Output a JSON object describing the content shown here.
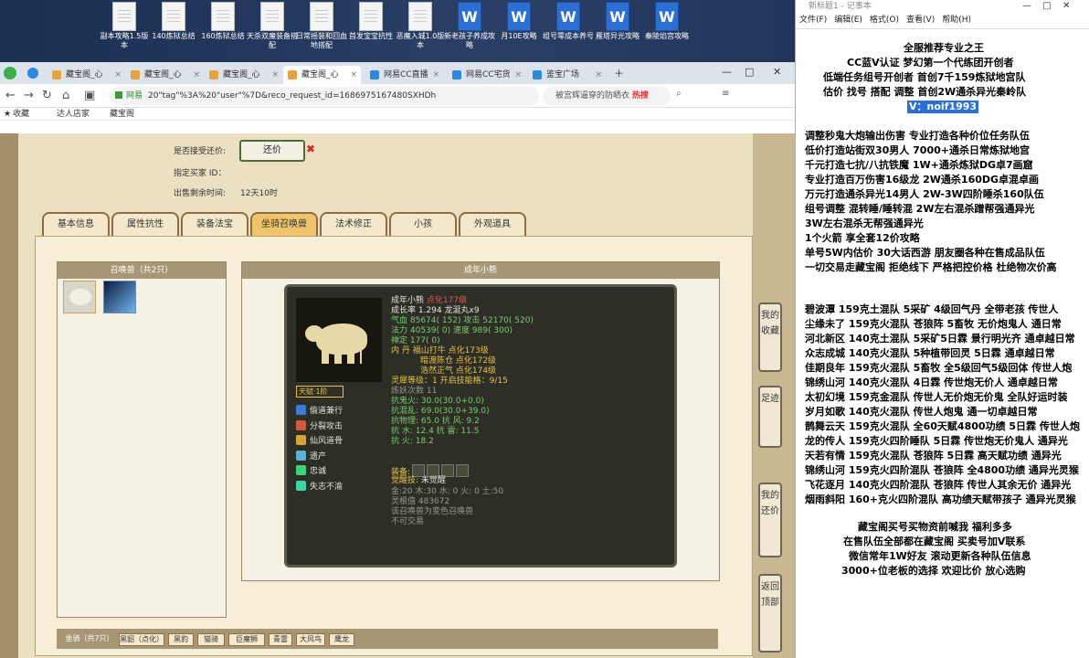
{
  "desktop": {
    "icons": [
      {
        "label": "副本攻略1.5版本",
        "word": false
      },
      {
        "label": "140炼狱总结",
        "word": false
      },
      {
        "label": "160炼狱总结",
        "word": false
      },
      {
        "label": "天杀双魔装备搭配",
        "word": false
      },
      {
        "label": "日常摇装和回血地搭配",
        "word": false
      },
      {
        "label": "首发宝宝抗性",
        "word": false
      },
      {
        "label": "恶魔入城1.0版本",
        "word": false
      },
      {
        "label": "新老孩子养成攻略",
        "word": true
      },
      {
        "label": "月10E攻略",
        "word": true
      },
      {
        "label": "组号零成本养号",
        "word": true
      },
      {
        "label": "雁塔异光攻略",
        "word": true
      },
      {
        "label": "秦陵焰宫攻略",
        "word": true
      }
    ]
  },
  "browser": {
    "tabs": [
      "藏宝阁_心",
      "藏宝阁_心",
      "藏宝阁_心",
      "藏宝阁_心",
      "网易CC直播",
      "网易CC宅货",
      "鉴宝广场"
    ],
    "url_site": "网易",
    "url": "20\"tag\"%3A%20\"user\"%7D&reco_request_id=1686975167480SXHDh",
    "search_text": "被宫辉逼穿的防晒衣",
    "hot_label": "热搜",
    "bookmarks": [
      "收藏",
      "达人店家",
      "藏宝阁"
    ]
  },
  "page": {
    "accept_label": "是否接受还价:",
    "counter_button": "还价",
    "buyer_label": "指定买家 ID：",
    "remaining_label": "出售剩余时间:",
    "remaining_value": "12天10时",
    "tabs": [
      "基本信息",
      "属性抗性",
      "装备法宝",
      "坐骑召唤兽",
      "法术修正",
      "小孩",
      "外观道具"
    ],
    "summon_header": "召唤兽（共2只）",
    "detail_header": "成年小熊",
    "pet": {
      "name_line": "成年小熊",
      "ding": "点化177级",
      "growth": "成长率 1.294 龙涎丸x9",
      "hp": "气血 85674( 152) 攻击 52170( 520)",
      "mp": "法力 40539( 0) 速度 989( 300)",
      "zen": "禅定 177( 0)",
      "neidan": "内  丹 福山打牛 点化173级",
      "neidan2": "暗渡陈仓 点化172级",
      "neidan3": "浩然正气 点化174级",
      "talent": "天赋·1阶",
      "spirit": "灵犀等级：1 开启技能格：9/15",
      "demon": "炼妖次数 11",
      "ghostfire": "抗鬼火: 30.0(30.0+0.0)",
      "chaos": "抗混乱: 69.0(30.0+39.0)",
      "poison": "抗物理: 65.0 抗   风: 9.2",
      "water": "抗   水: 12.4 抗   雷: 11.5",
      "fire": "抗   火: 18.2",
      "equip_label": "装备:",
      "awaken_label": "觉醒技:",
      "awaken_value": "未觉醒",
      "elements": "金:20 木:30 水: 0 火: 0 土:50",
      "jinglin": "灵根值 483672",
      "note1": "该召唤兽为变色召唤兽",
      "note2": "不可交易",
      "skills": [
        "偷道兼行",
        "分裂攻击",
        "仙风道骨",
        "遗产",
        "忠诚",
        "失志不渝"
      ]
    },
    "bottom_tabs": [
      "坐骑（共7只）",
      "黑貂（点化）",
      "黑豹",
      "猫骑",
      "巨魔狮",
      "青雷",
      "大风鸟",
      "鹰龙"
    ],
    "side_buttons": [
      "我的收藏",
      "足迹",
      "我的还价",
      "返回顶部"
    ]
  },
  "notepad": {
    "title": "新标题1 - 记事本",
    "menu": [
      "文件(F)",
      "编辑(E)",
      "格式(O)",
      "查看(V)",
      "帮助(H)"
    ],
    "lines": [
      "全服推荐专业之王",
      "CC蓝V认证 梦幻第一个代练团开创者",
      "低端任务组号开创者        首创7千159炼狱地宫队",
      "估价 找号 搭配 调整        首创2W通杀异光秦岭队",
      "V：noif1993",
      "调整秒鬼大炮输出伤害          专业打造各种价位任务队伍",
      "低价打造站街双30男人            7000+通杀日常炼狱地宫",
      "千元打造七抗/八抗铁魔           1W+通杀炼狱DG卓7画窟",
      "专业打造百万伤害16级龙           2W通杀160DG卓混卓画",
      "万元打造通杀异光14男人         2W-3W四阶睡杀160队伍",
      "组号调整 混转睡/睡转混           2W左右混杀蹭帮强通异光",
      "                                             3W左右混杀无帮强通异光",
      "1个火箭 享全套12价攻略",
      "单号5W内估价 30大话西游         朋友圈各种在售成品队伍",
      "一切交易走藏宝阁 拒绝线下    严格把控价格 杜绝物次价高",
      "碧波潭    159克土混队 5采矿 4级回气丹 全带老孩 传世人",
      "尘缘未了 159克火混队 苍狼阵 5畜牧 无价炮鬼人 通日常",
      "河北新区 140克土混队 5采矿5日霖 景行明光齐 通卓越日常",
      "众志成城 140克火混队 5种植带回灵 5日霖 通卓越日常",
      "佳期良年 159克火混队 5畜牧 全5级回气5级回体 传世人炮",
      "锦绣山河 140克火混队 4日霖 传世炮无价人  通卓越日常",
      "太初幻境 159克金混队 传世人无价炮无价鬼 全队好运时装",
      "岁月如歌 140克火混队 传世人炮鬼  通一切卓越日常",
      "鹊舞云天 159克火混队 全60天赋4800功绩 5日霖 传世人炮",
      "龙的传人 159克火四阶睡队 5日霖 传世炮无价鬼人 通异光",
      "天若有情 159克火混队 苍狼阵  5日霖 高天赋功绩 通异光",
      "锦绣山河 159克火四阶混队 苍狼阵 全4800功绩 通异光灵猴",
      "飞花逐月 140克火四阶混队 苍狼阵 传世人其余无价 通异光",
      "烟雨斜阳 160+克火四阶混队 高功绩天赋带孩子 通异光灵猴",
      "藏宝阁买号买物资前喊我 福利多多",
      "在售队伍全部都在藏宝阁 买卖号加V联系",
      "微信常年1W好友 滚动更新各种队伍信息",
      "3000+位老板的选择 欢迎比价 放心选购"
    ]
  },
  "colors": {
    "accent": "#2a6fd8",
    "game_gold": "#e6c24b",
    "game_red": "#e25a4a"
  }
}
